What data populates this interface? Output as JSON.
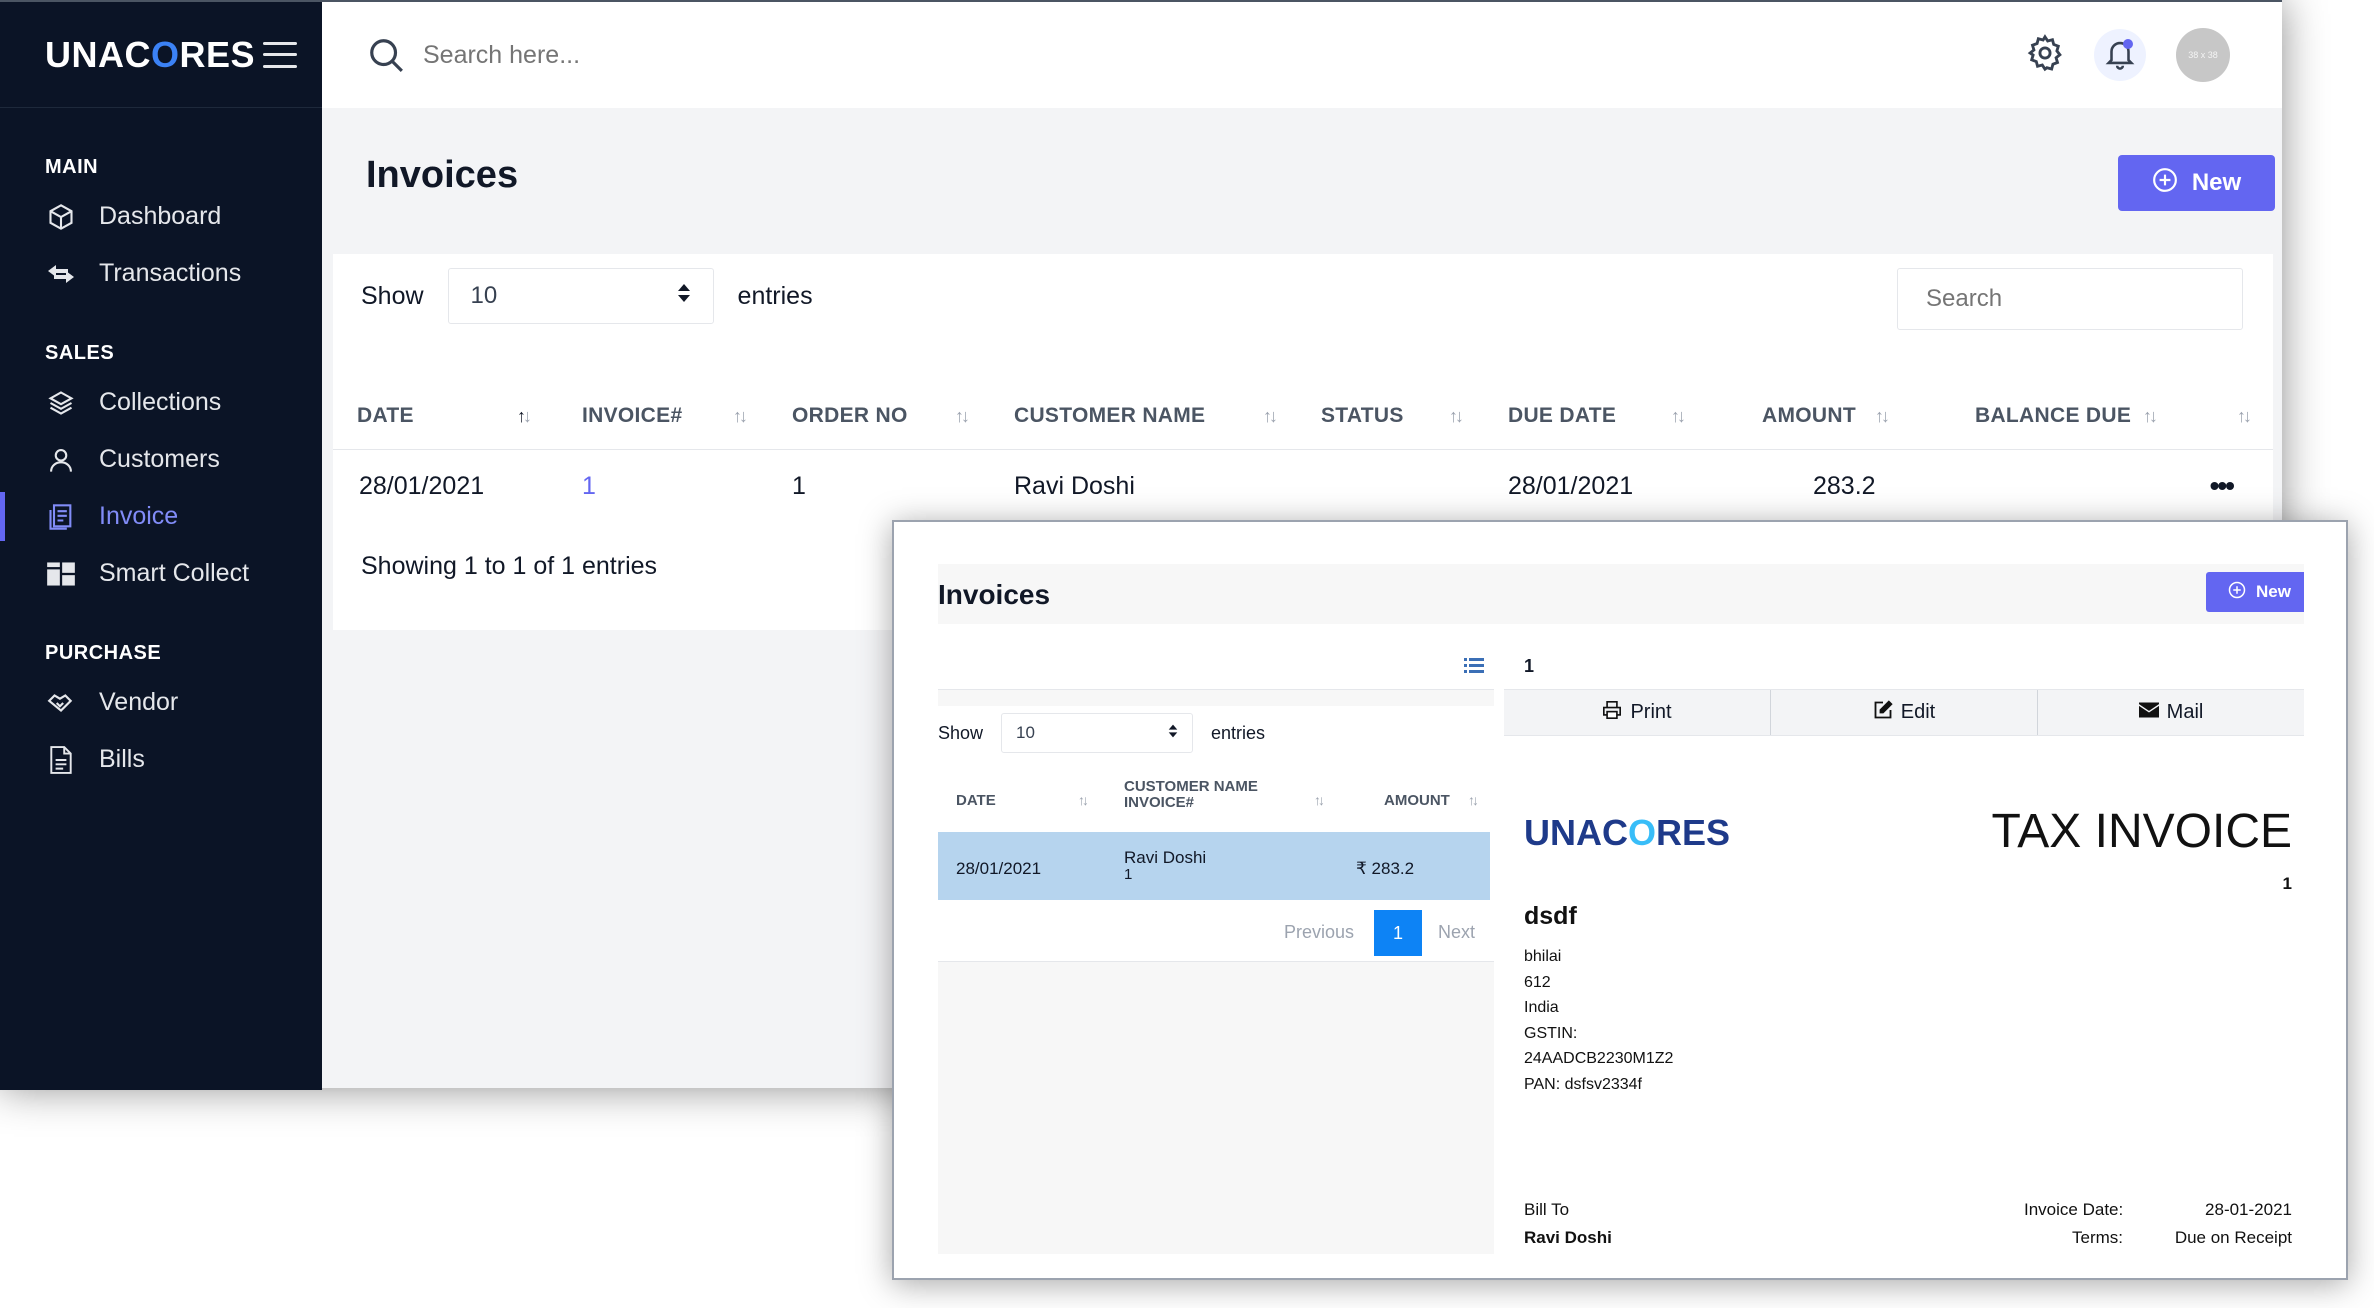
{
  "app": {
    "brand_pre": "UNAC",
    "brand_o": "O",
    "brand_post": "RES",
    "accent_color": "#6366f1",
    "sidebar_bg": "#0b1426"
  },
  "topbar": {
    "search_placeholder": "Search here...",
    "avatar_text": "38 x 38"
  },
  "sidebar": {
    "sections": [
      {
        "title": "MAIN",
        "items": [
          {
            "label": "Dashboard",
            "icon": "cube-icon"
          },
          {
            "label": "Transactions",
            "icon": "arrows-exchange-icon"
          }
        ]
      },
      {
        "title": "SALES",
        "items": [
          {
            "label": "Collections",
            "icon": "layers-icon"
          },
          {
            "label": "Customers",
            "icon": "user-icon"
          },
          {
            "label": "Invoice",
            "icon": "invoice-icon",
            "active": true
          },
          {
            "label": "Smart Collect",
            "icon": "dashboard-grid-icon"
          }
        ]
      },
      {
        "title": "PURCHASE",
        "items": [
          {
            "label": "Vendor",
            "icon": "handshake-icon"
          },
          {
            "label": "Bills",
            "icon": "document-icon"
          }
        ]
      }
    ]
  },
  "main": {
    "title": "Invoices",
    "new_label": "New",
    "show_label": "Show",
    "entries_value": "10",
    "entries_label": "entries",
    "search_placeholder": "Search",
    "columns": [
      "DATE",
      "INVOICE#",
      "ORDER NO",
      "CUSTOMER NAME",
      "STATUS",
      "DUE DATE",
      "AMOUNT",
      "BALANCE DUE"
    ],
    "rows": [
      {
        "date": "28/01/2021",
        "invoice": "1",
        "order_no": "1",
        "customer": "Ravi Doshi",
        "status": "",
        "due_date": "28/01/2021",
        "amount": "283.2",
        "balance_due": ""
      }
    ],
    "showing_text": "Showing 1 to 1 of 1 entries"
  },
  "popup": {
    "title": "Invoices",
    "new_label": "New",
    "show_label": "Show",
    "entries_value": "10",
    "entries_label": "entries",
    "columns": {
      "date": "DATE",
      "customer_name": "CUSTOMER NAME",
      "invoice": "INVOICE#",
      "amount": "AMOUNT"
    },
    "row": {
      "date": "28/01/2021",
      "customer": "Ravi Doshi",
      "invoice": "1",
      "amount": "₹ 283.2"
    },
    "pagination": {
      "previous": "Previous",
      "current": "1",
      "next": "Next"
    },
    "detail": {
      "invoice_id": "1",
      "actions": {
        "print": "Print",
        "edit": "Edit",
        "mail": "Mail"
      },
      "logo_pre": "UNAC",
      "logo_o": "O",
      "logo_post": "RES",
      "heading": "TAX INVOICE",
      "number": "1",
      "company": "dsdf",
      "address_lines": [
        "bhilai",
        "612",
        "India",
        "GSTIN:",
        "24AADCB2230M1Z2",
        "PAN: dsfsv2334f"
      ],
      "bill_to_label": "Bill To",
      "bill_to_name": "Ravi Doshi",
      "invoice_date_label": "Invoice Date:",
      "invoice_date_value": "28-01-2021",
      "terms_label": "Terms:",
      "terms_value": "Due on Receipt"
    }
  }
}
